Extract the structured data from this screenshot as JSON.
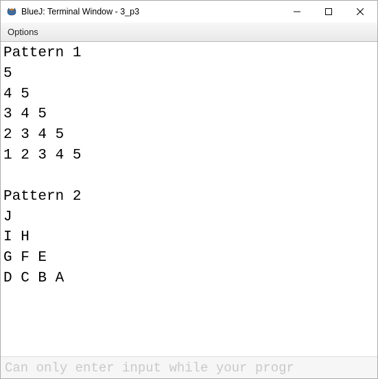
{
  "titlebar": {
    "title": "BlueJ: Terminal Window - 3_p3"
  },
  "menubar": {
    "options_label": "Options"
  },
  "terminal": {
    "output": "Pattern 1\n5\n4 5\n3 4 5\n2 3 4 5\n1 2 3 4 5\n\nPattern 2\nJ\nI H\nG F E\nD C B A"
  },
  "input": {
    "placeholder": "Can only enter input while your progr"
  }
}
